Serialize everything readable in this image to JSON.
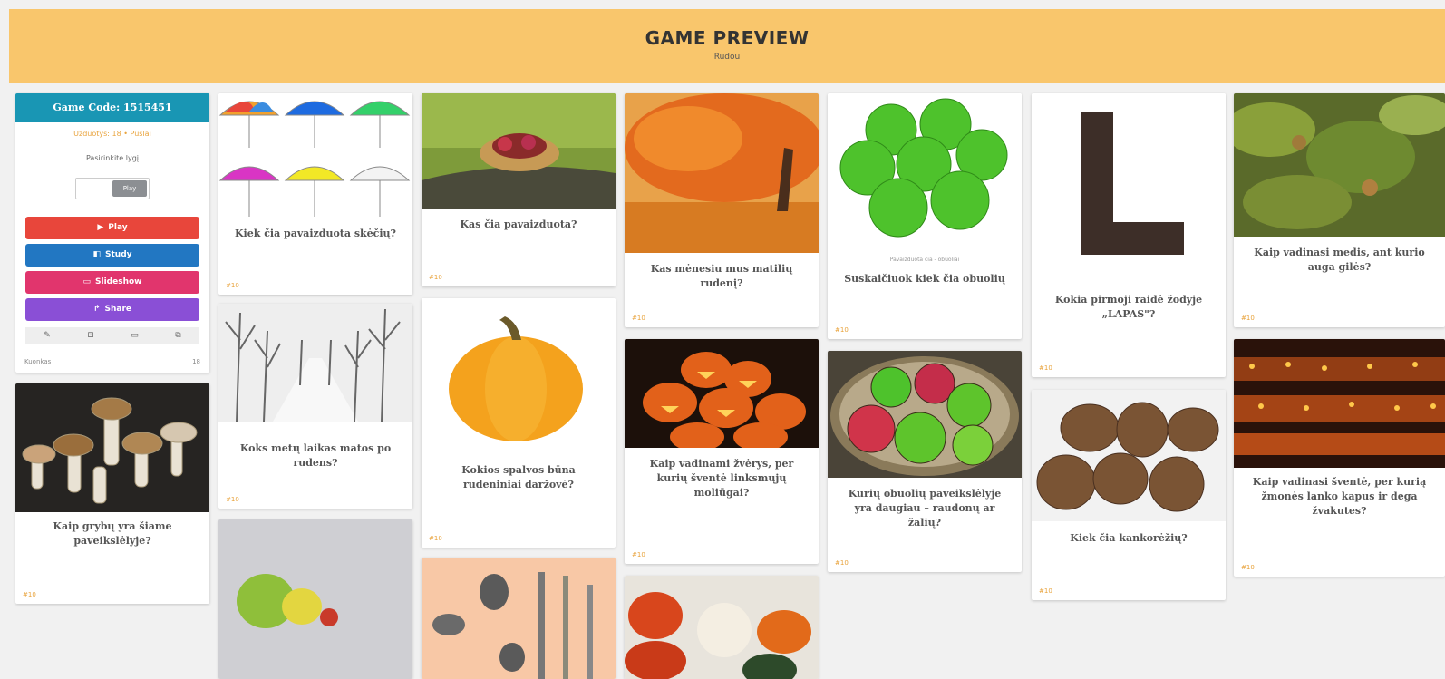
{
  "header": {
    "title": "GAME PREVIEW",
    "subtitle": "Rudou"
  },
  "info_card": {
    "code_label": "Game Code: 1515451",
    "stats": "Uzduotys: 18 • Puslai",
    "play_label": "Pasirinkite lygį",
    "control_value": "",
    "go_label": "Play",
    "buttons": [
      {
        "icon": "▶",
        "label": "Play",
        "color": "#e8463b"
      },
      {
        "icon": "◧",
        "label": "Study",
        "color": "#2277c2"
      },
      {
        "icon": "▭",
        "label": "Slideshow",
        "color": "#e1356d"
      },
      {
        "icon": "↱",
        "label": "Share",
        "color": "#8a4fd6"
      }
    ],
    "tool_icons": [
      "✎",
      "⊡",
      "▭",
      "⧉"
    ],
    "owner": "Kuonkas",
    "count": "18"
  },
  "cards": [
    {
      "question": "Kiek čia pavaizduota skėčių?",
      "meta": "#10"
    },
    {
      "question": "Kaip grybų yra šiame paveikslėlyje?",
      "meta": "#10"
    },
    {
      "question": "Koks metų laikas matos po rudens?",
      "meta": "#10"
    },
    {
      "question": "Kas čia pavaizduota?",
      "meta": "#10"
    },
    {
      "question": "Kokios spalvos būna rudeniniai daržovė?",
      "meta": "#10"
    },
    {
      "question": "Kas mėnesiu mus matilių rudenį?",
      "meta": "#10"
    },
    {
      "question": "Kaip vadinami žvėrys, per kurių šventė linksmųjų moliūgai?",
      "meta": "#10"
    },
    {
      "question": "Suskaičiuok kiek čia obuolių",
      "meta": "#10",
      "credit": "Pavaizduota čia - obuoliai"
    },
    {
      "question": "Kurių obuolių paveikslėlyje yra daugiau – raudonų ar žalių?",
      "meta": "#10"
    },
    {
      "question": "Kokia pirmoji raidė žodyje „LAPAS\"?",
      "meta": "#10"
    },
    {
      "question": "Kiek čia kankorėžių?",
      "meta": "#10"
    },
    {
      "question": "Kaip vadinasi medis, ant kurio auga gilės?",
      "meta": "#10"
    },
    {
      "question": "Kaip vadinasi šventė, per kurią žmonės lanko kapus ir dega žvakutes?",
      "meta": "#10"
    }
  ]
}
